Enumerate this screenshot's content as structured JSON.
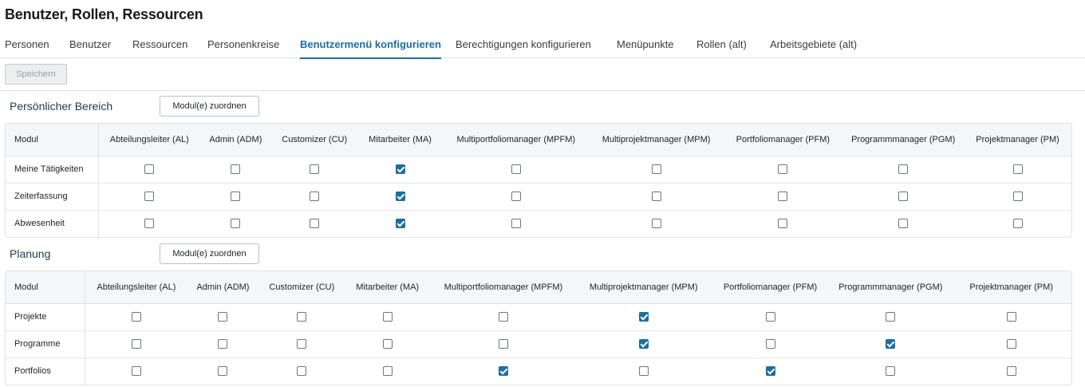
{
  "page": {
    "title": "Benutzer, Rollen, Ressourcen"
  },
  "tabs": [
    {
      "label": "Personen",
      "active": false
    },
    {
      "label": "Benutzer",
      "active": false
    },
    {
      "label": "Ressourcen",
      "active": false
    },
    {
      "label": "Personenkreise",
      "active": false
    },
    {
      "label": "Benutzermenü konfigurieren",
      "active": true
    },
    {
      "label": "Berechtigungen konfigurieren",
      "active": false
    },
    {
      "label": "Menüpunkte",
      "active": false
    },
    {
      "label": "Rollen (alt)",
      "active": false
    },
    {
      "label": "Arbeitsgebiete (alt)",
      "active": false
    }
  ],
  "toolbar": {
    "save_label": "Speichern",
    "save_disabled": true
  },
  "columns": [
    "Modul",
    "Abteilungsleiter (AL)",
    "Admin (ADM)",
    "Customizer (CU)",
    "Mitarbeiter (MA)",
    "Multiportfoliomanager (MPFM)",
    "Multiprojektmanager (MPM)",
    "Portfoliomanager (PFM)",
    "Programmmanager (PGM)",
    "Projektmanager (PM)"
  ],
  "sections": [
    {
      "title": "Persönlicher Bereich",
      "assign_label": "Modul(e) zuordnen",
      "rows": [
        {
          "modul": "Meine Tätigkeiten",
          "checks": [
            false,
            false,
            false,
            true,
            false,
            false,
            false,
            false,
            false
          ]
        },
        {
          "modul": "Zeiterfassung",
          "checks": [
            false,
            false,
            false,
            true,
            false,
            false,
            false,
            false,
            false
          ]
        },
        {
          "modul": "Abwesenheit",
          "checks": [
            false,
            false,
            false,
            true,
            false,
            false,
            false,
            false,
            false
          ]
        }
      ]
    },
    {
      "title": "Planung",
      "assign_label": "Modul(e) zuordnen",
      "rows": [
        {
          "modul": "Projekte",
          "checks": [
            false,
            false,
            false,
            false,
            false,
            true,
            false,
            false,
            false
          ]
        },
        {
          "modul": "Programme",
          "checks": [
            false,
            false,
            false,
            false,
            false,
            true,
            false,
            true,
            false
          ]
        },
        {
          "modul": "Portfolios",
          "checks": [
            false,
            false,
            false,
            false,
            true,
            false,
            true,
            false,
            false
          ]
        }
      ]
    }
  ],
  "colors": {
    "accent": "#1c6ea4",
    "header_bg": "#f5f6f7",
    "border": "#dee2e6"
  }
}
